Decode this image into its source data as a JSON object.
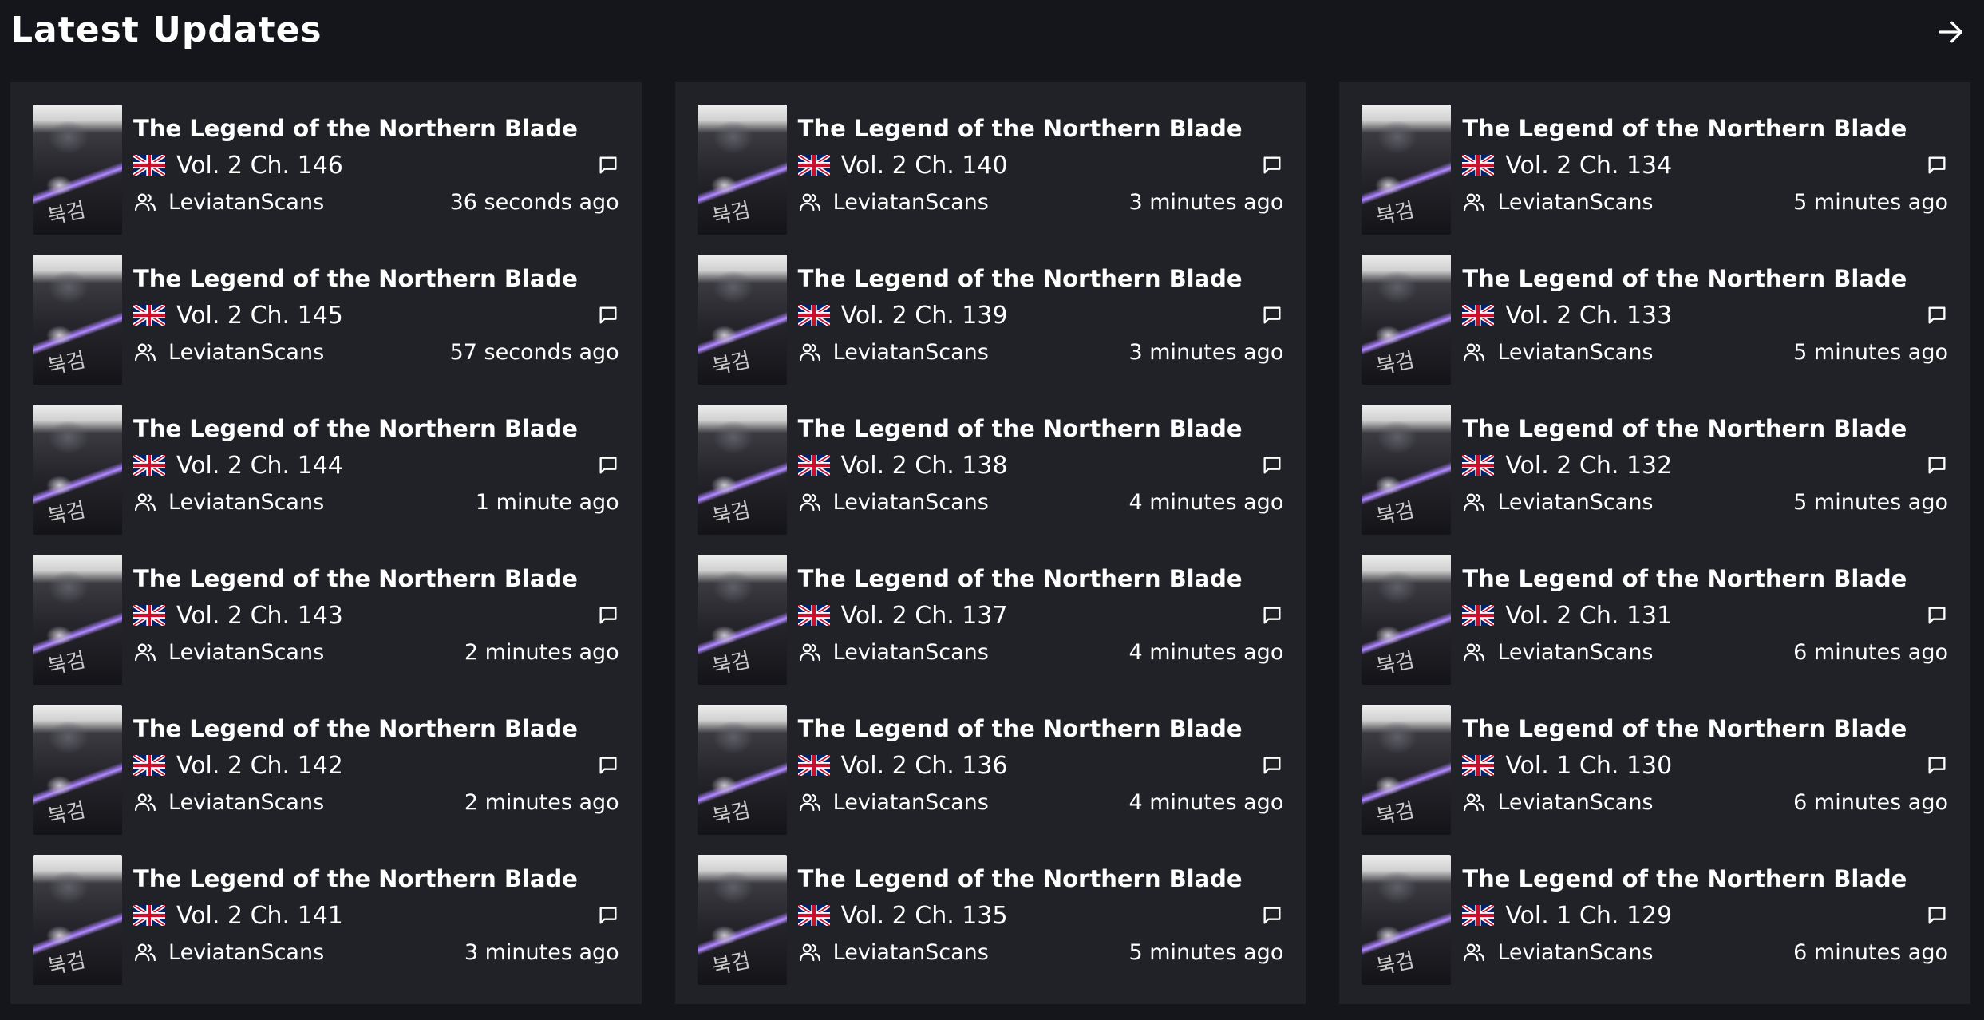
{
  "header": {
    "title": "Latest Updates",
    "arrow_icon": "arrow-right-icon"
  },
  "columns": [
    {
      "entries": [
        {
          "title": "The Legend of the Northern Blade",
          "chapter": "Vol. 2 Ch. 146",
          "group": "LeviatanScans",
          "time": "36 seconds ago"
        },
        {
          "title": "The Legend of the Northern Blade",
          "chapter": "Vol. 2 Ch. 145",
          "group": "LeviatanScans",
          "time": "57 seconds ago"
        },
        {
          "title": "The Legend of the Northern Blade",
          "chapter": "Vol. 2 Ch. 144",
          "group": "LeviatanScans",
          "time": "1 minute ago"
        },
        {
          "title": "The Legend of the Northern Blade",
          "chapter": "Vol. 2 Ch. 143",
          "group": "LeviatanScans",
          "time": "2 minutes ago"
        },
        {
          "title": "The Legend of the Northern Blade",
          "chapter": "Vol. 2 Ch. 142",
          "group": "LeviatanScans",
          "time": "2 minutes ago"
        },
        {
          "title": "The Legend of the Northern Blade",
          "chapter": "Vol. 2 Ch. 141",
          "group": "LeviatanScans",
          "time": "3 minutes ago"
        }
      ]
    },
    {
      "entries": [
        {
          "title": "The Legend of the Northern Blade",
          "chapter": "Vol. 2 Ch. 140",
          "group": "LeviatanScans",
          "time": "3 minutes ago"
        },
        {
          "title": "The Legend of the Northern Blade",
          "chapter": "Vol. 2 Ch. 139",
          "group": "LeviatanScans",
          "time": "3 minutes ago"
        },
        {
          "title": "The Legend of the Northern Blade",
          "chapter": "Vol. 2 Ch. 138",
          "group": "LeviatanScans",
          "time": "4 minutes ago"
        },
        {
          "title": "The Legend of the Northern Blade",
          "chapter": "Vol. 2 Ch. 137",
          "group": "LeviatanScans",
          "time": "4 minutes ago"
        },
        {
          "title": "The Legend of the Northern Blade",
          "chapter": "Vol. 2 Ch. 136",
          "group": "LeviatanScans",
          "time": "4 minutes ago"
        },
        {
          "title": "The Legend of the Northern Blade",
          "chapter": "Vol. 2 Ch. 135",
          "group": "LeviatanScans",
          "time": "5 minutes ago"
        }
      ]
    },
    {
      "entries": [
        {
          "title": "The Legend of the Northern Blade",
          "chapter": "Vol. 2 Ch. 134",
          "group": "LeviatanScans",
          "time": "5 minutes ago"
        },
        {
          "title": "The Legend of the Northern Blade",
          "chapter": "Vol. 2 Ch. 133",
          "group": "LeviatanScans",
          "time": "5 minutes ago"
        },
        {
          "title": "The Legend of the Northern Blade",
          "chapter": "Vol. 2 Ch. 132",
          "group": "LeviatanScans",
          "time": "5 minutes ago"
        },
        {
          "title": "The Legend of the Northern Blade",
          "chapter": "Vol. 2 Ch. 131",
          "group": "LeviatanScans",
          "time": "6 minutes ago"
        },
        {
          "title": "The Legend of the Northern Blade",
          "chapter": "Vol. 1 Ch. 130",
          "group": "LeviatanScans",
          "time": "6 minutes ago"
        },
        {
          "title": "The Legend of the Northern Blade",
          "chapter": "Vol. 1 Ch. 129",
          "group": "LeviatanScans",
          "time": "6 minutes ago"
        }
      ]
    }
  ],
  "icons": {
    "flag": "uk-flag-icon",
    "comment": "comment-icon",
    "group": "users-icon"
  },
  "colors": {
    "background": "#14161b",
    "card": "#202227",
    "text": "#ffffff"
  }
}
